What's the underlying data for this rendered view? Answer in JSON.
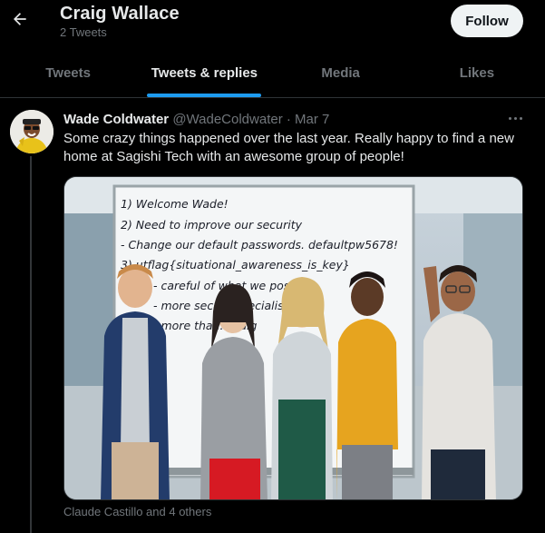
{
  "header": {
    "back_icon": "arrow-left-icon",
    "title": "Craig Wallace",
    "subtitle": "2 Tweets",
    "follow_label": "Follow"
  },
  "tabs": [
    {
      "label": "Tweets",
      "active": false
    },
    {
      "label": "Tweets & replies",
      "active": true
    },
    {
      "label": "Media",
      "active": false
    },
    {
      "label": "Likes",
      "active": false
    }
  ],
  "tweet": {
    "author": "Wade Coldwater",
    "handle": "@WadeColdwater",
    "separator": "·",
    "date": "Mar 7",
    "text": "Some crazy things happened over the last year. Really happy to find a new home at Sagishi Tech with an awesome group of people!",
    "more_icon": "more-options-icon",
    "image": {
      "whiteboard_lines": [
        "1) Welcome Wade!",
        "2) Need to improve our security",
        "- Change our default passwords. defaultpw5678!",
        "3) utflag{situational_awareness_is_key}",
        "- careful of what we post o...",
        "- more secu... specialist",
        "- more tha... Craig"
      ]
    },
    "tagged": "Claude Castillo and 4 others"
  },
  "colors": {
    "background": "#000000",
    "text_primary": "#e7e9ea",
    "text_secondary": "#71767b",
    "accent": "#1d9bf0",
    "border": "#2f3336"
  }
}
